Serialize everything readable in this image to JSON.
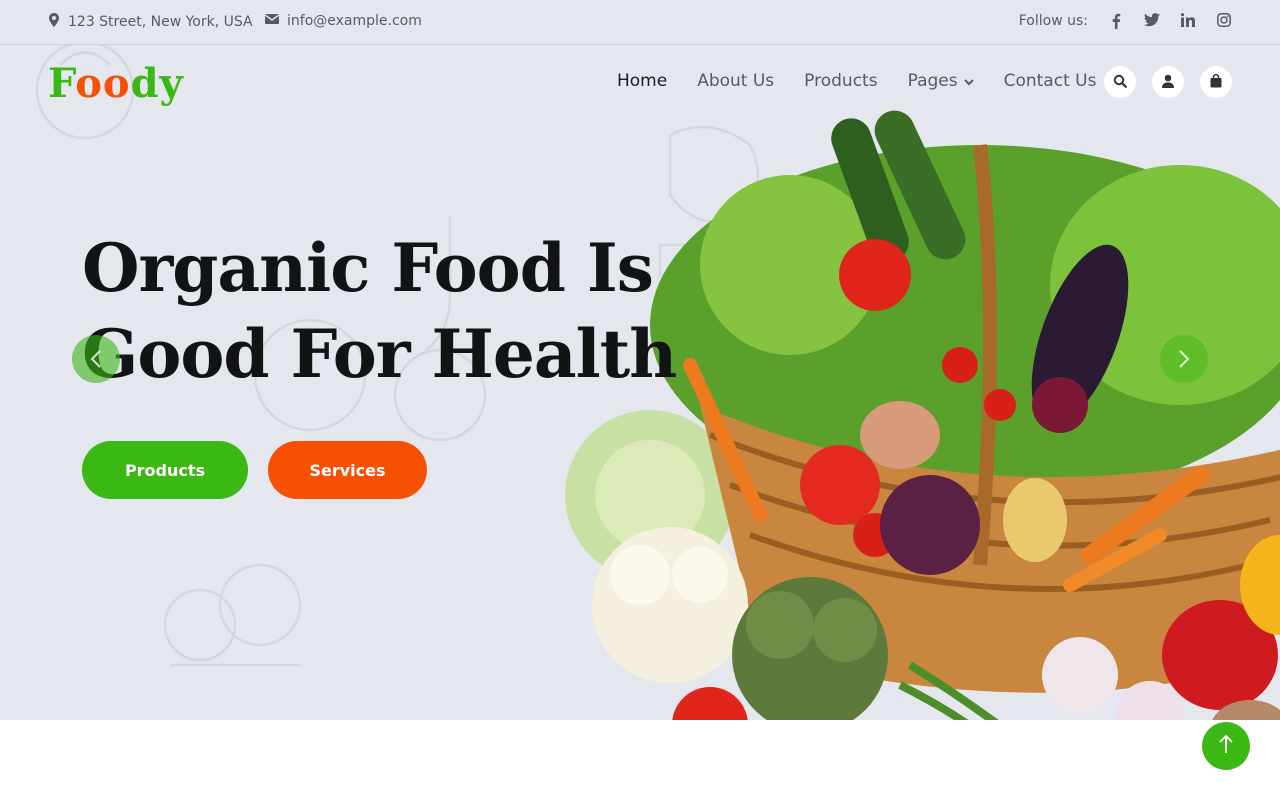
{
  "topbar": {
    "address": "123 Street, New York, USA",
    "email": "info@example.com",
    "follow_label": "Follow us:",
    "social": [
      "facebook-icon",
      "twitter-icon",
      "linkedin-icon",
      "instagram-icon"
    ]
  },
  "brand": {
    "logo_first": "F",
    "logo_mid": "oo",
    "logo_last": "dy",
    "green": "#3cb815",
    "orange": "#f65005"
  },
  "nav": {
    "items": [
      {
        "label": "Home",
        "active": true
      },
      {
        "label": "About Us"
      },
      {
        "label": "Products"
      },
      {
        "label": "Pages",
        "dropdown": true
      },
      {
        "label": "Contact Us"
      }
    ]
  },
  "actions": [
    "search-icon",
    "user-icon",
    "shopping-bag-icon"
  ],
  "hero": {
    "line1": "Organic Food Is",
    "line2": "Good For Health",
    "btn_products": "Products",
    "btn_services": "Services",
    "image": "vegetable-basket"
  }
}
